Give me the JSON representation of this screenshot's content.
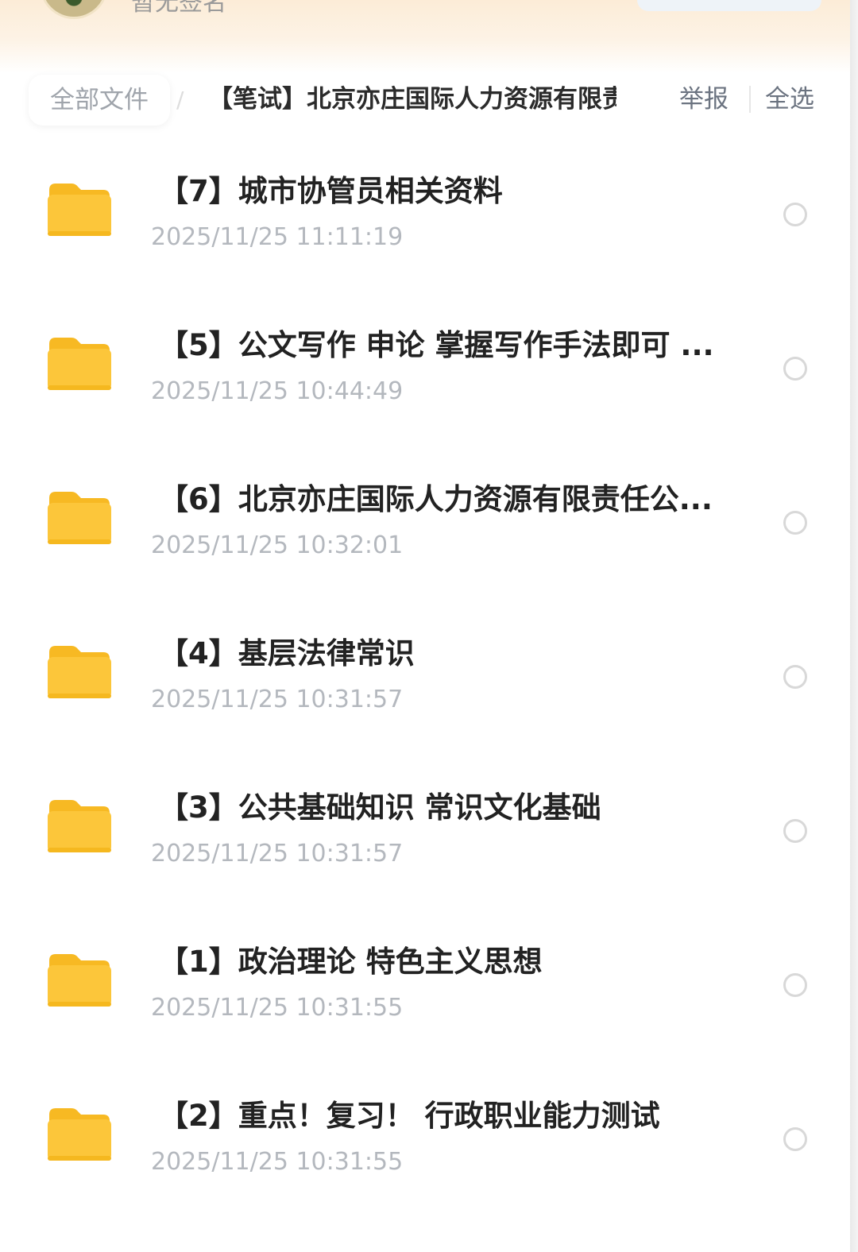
{
  "header": {
    "signature": "暂无签名"
  },
  "breadcrumb": {
    "root_label": "全部文件",
    "separator": "/",
    "current": "【笔试】北京亦庄国际人力资源有限责"
  },
  "toolbar": {
    "report_label": "举报",
    "select_all_label": "全选"
  },
  "files": [
    {
      "name": "【7】城市协管员相关资料",
      "time": "2025/11/25 11:11:19"
    },
    {
      "name": "【5】公文写作 申论 掌握写作手法即可 ...",
      "time": "2025/11/25 10:44:49"
    },
    {
      "name": "【6】北京亦庄国际人力资源有限责任公...",
      "time": "2025/11/25 10:32:01"
    },
    {
      "name": "【4】基层法律常识",
      "time": "2025/11/25 10:31:57"
    },
    {
      "name": "【3】公共基础知识 常识文化基础",
      "time": "2025/11/25 10:31:57"
    },
    {
      "name": "【1】政治理论 特色主义思想",
      "time": "2025/11/25 10:31:55"
    },
    {
      "name": "【2】重点！复习！ 行政职业能力测试",
      "time": "2025/11/25 10:31:55"
    }
  ],
  "colors": {
    "folder": "#fcc63a",
    "folder_tab": "#f7b923",
    "title_text": "#222222",
    "time_text": "#b4b8be"
  }
}
